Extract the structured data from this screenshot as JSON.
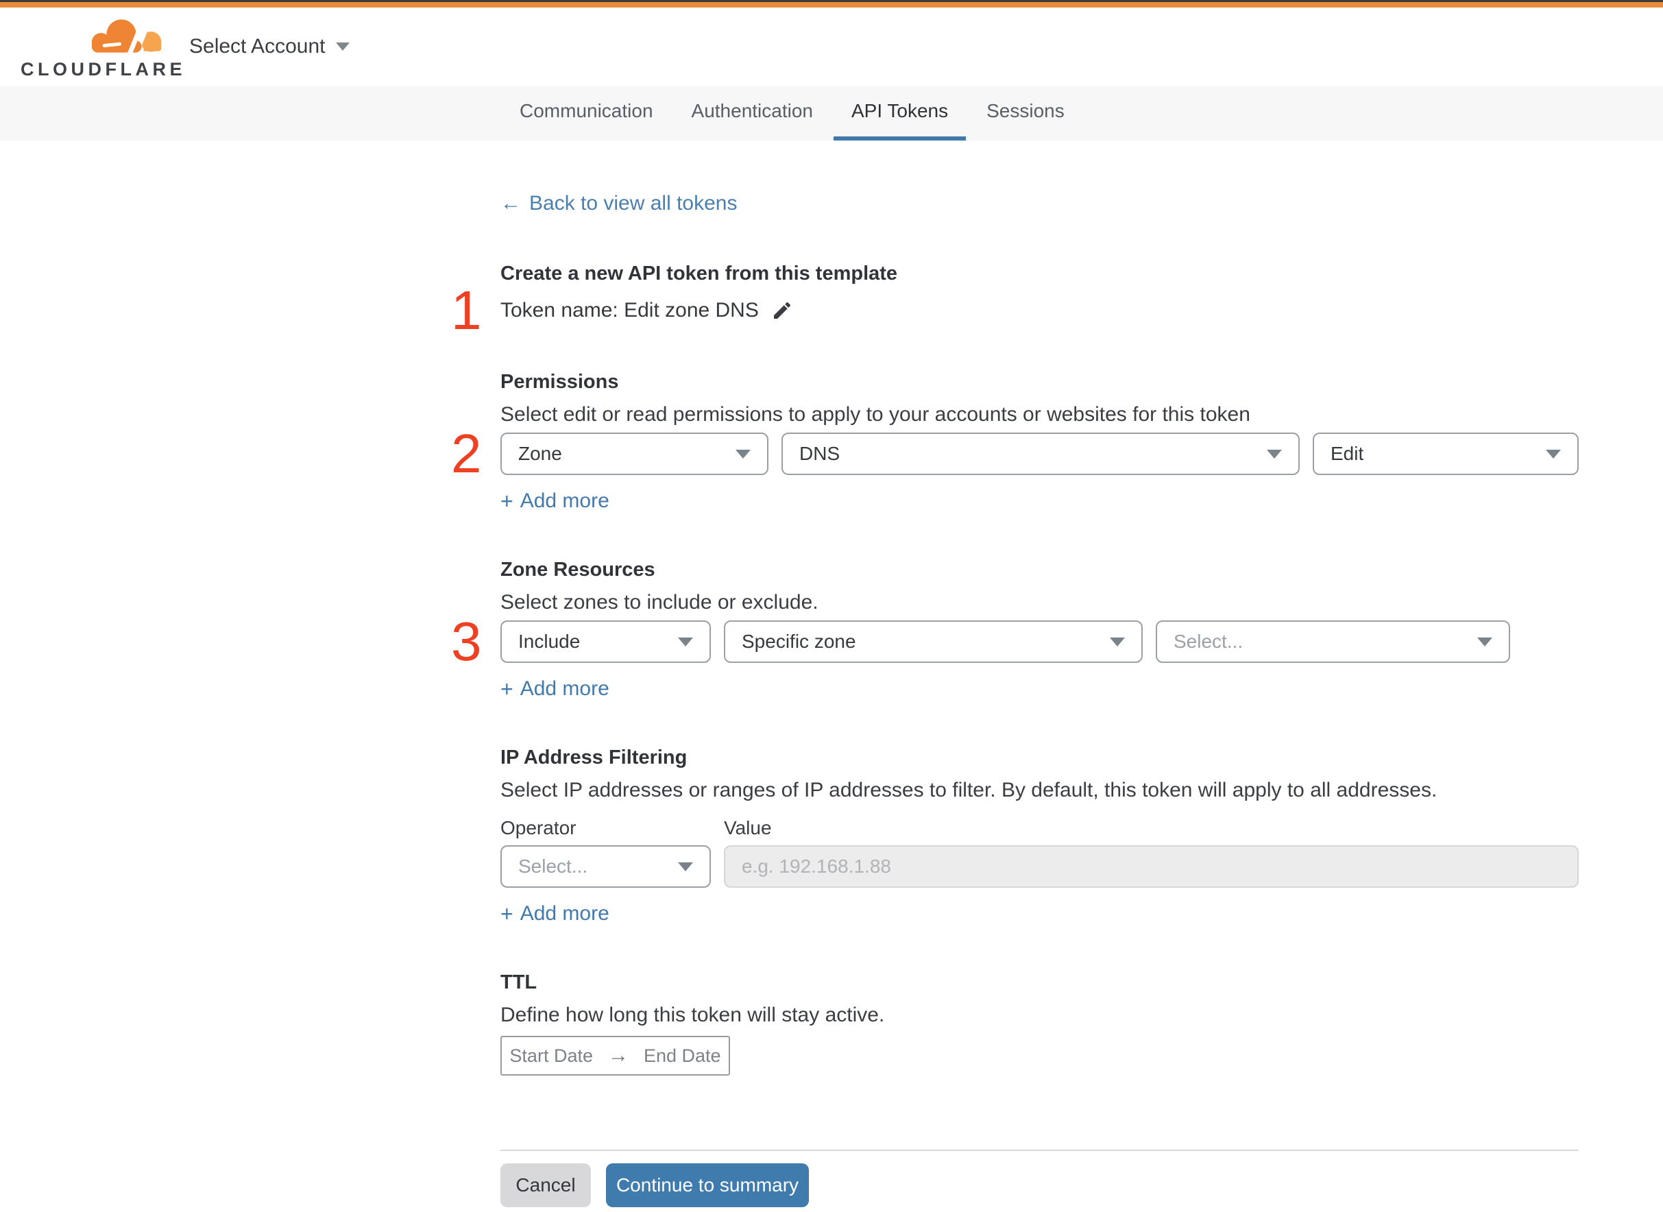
{
  "header": {
    "brand": "CLOUDFLARE",
    "account_selector_label": "Select Account"
  },
  "tabs": [
    {
      "label": "Communication",
      "active": false
    },
    {
      "label": "Authentication",
      "active": false
    },
    {
      "label": "API Tokens",
      "active": true
    },
    {
      "label": "Sessions",
      "active": false
    }
  ],
  "back_link": {
    "arrow": "←",
    "label": "Back to view all tokens"
  },
  "steps": {
    "one": "1",
    "two": "2",
    "three": "3"
  },
  "template_section": {
    "title": "Create a new API token from this template",
    "token_name": "Token name: Edit zone DNS"
  },
  "permissions": {
    "title": "Permissions",
    "description": "Select edit or read permissions to apply to your accounts or websites for this token",
    "scope_value": "Zone",
    "resource_value": "DNS",
    "access_value": "Edit",
    "plus": "+",
    "add_more": "Add more"
  },
  "zone_resources": {
    "title": "Zone Resources",
    "description": "Select zones to include or exclude.",
    "operator_value": "Include",
    "type_value": "Specific zone",
    "zone_placeholder": "Select...",
    "plus": "+",
    "add_more": "Add more"
  },
  "ip_filtering": {
    "title": "IP Address Filtering",
    "description": "Select IP addresses or ranges of IP addresses to filter. By default, this token will apply to all addresses.",
    "operator_label": "Operator",
    "value_label": "Value",
    "operator_placeholder": "Select...",
    "value_placeholder": "e.g. 192.168.1.88",
    "plus": "+",
    "add_more": "Add more"
  },
  "ttl": {
    "title": "TTL",
    "description": "Define how long this token will stay active.",
    "start_label": "Start Date",
    "arrow": "→",
    "end_label": "End Date"
  },
  "footer": {
    "cancel_label": "Cancel",
    "continue_label": "Continue to summary"
  },
  "colors": {
    "brand_orange": "#e88b3a",
    "logo_orange": "#ee8434",
    "logo_light_orange": "#f6a54e",
    "link_blue": "#4a7fae",
    "button_blue": "#3f7cad",
    "tab_underline_blue": "#4278a9",
    "annotation_red": "#ee4023",
    "tabbar_gray": "#f7f7f8"
  }
}
